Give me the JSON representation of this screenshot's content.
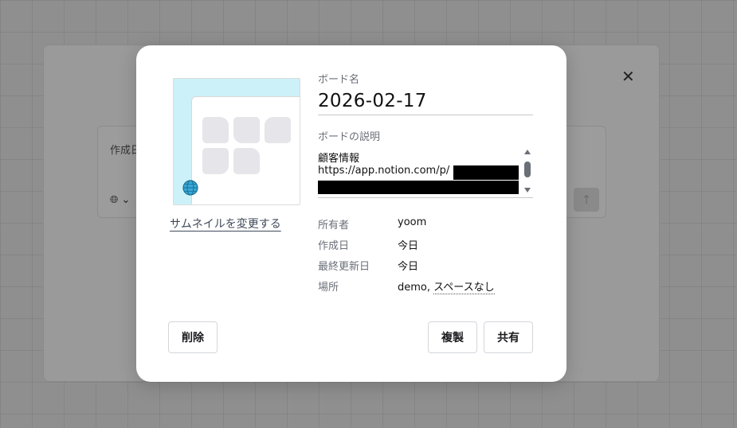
{
  "background": {
    "card_label": "作成日",
    "language_icon": "globe-icon",
    "send_icon": "arrow-up-icon"
  },
  "modal": {
    "thumbnail": {
      "change_label": "サムネイルを変更する",
      "badge_icon": "globe-icon",
      "accent": "#cdf1f8"
    },
    "name": {
      "label": "ボード名",
      "value": "2026-02-17"
    },
    "description": {
      "label": "ボードの説明",
      "line1": "顧客情報",
      "line2": "https://app.notion.com/p/"
    },
    "meta": [
      {
        "key": "所有者",
        "value": "yoom"
      },
      {
        "key": "作成日",
        "value": "今日"
      },
      {
        "key": "最終更新日",
        "value": "今日"
      },
      {
        "key": "場所",
        "value": "demo,",
        "link": "スペースなし"
      }
    ],
    "buttons": {
      "delete": "削除",
      "duplicate": "複製",
      "share": "共有"
    },
    "close_icon": "close-icon"
  }
}
